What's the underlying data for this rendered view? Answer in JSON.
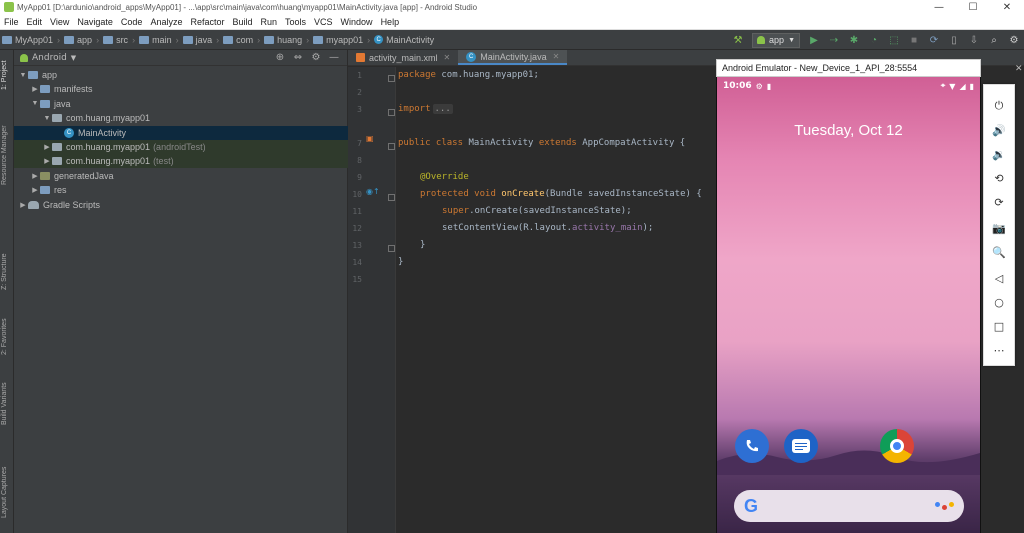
{
  "window": {
    "title": "MyApp01 [D:\\ardunio\\android_apps\\MyApp01] - ...\\app\\src\\main\\java\\com\\huang\\myapp01\\MainActivity.java [app] - Android Studio",
    "minimize": "—",
    "maximize": "☐",
    "close": "✕"
  },
  "menu": [
    "File",
    "Edit",
    "View",
    "Navigate",
    "Code",
    "Analyze",
    "Refactor",
    "Build",
    "Run",
    "Tools",
    "VCS",
    "Window",
    "Help"
  ],
  "breadcrumb": [
    "MyApp01",
    "app",
    "src",
    "main",
    "java",
    "com",
    "huang",
    "myapp01",
    "MainActivity"
  ],
  "toolbar": {
    "run_config": "app"
  },
  "left_stripe": [
    "1: Project",
    "Resource Manager",
    "Z: Structure",
    "2: Favorites",
    "Build Variants",
    "Layout Captures"
  ],
  "project": {
    "view_mode": "Android",
    "tree": [
      {
        "label": "app",
        "suffix": "",
        "indent": 0,
        "arrow": "▼",
        "icon": "folder"
      },
      {
        "label": "manifests",
        "suffix": "",
        "indent": 1,
        "arrow": "▶",
        "icon": "folder"
      },
      {
        "label": "java",
        "suffix": "",
        "indent": 1,
        "arrow": "▼",
        "icon": "folder"
      },
      {
        "label": "com.huang.myapp01",
        "suffix": "",
        "indent": 2,
        "arrow": "▼",
        "icon": "pkg"
      },
      {
        "label": "MainActivity",
        "suffix": "",
        "indent": 3,
        "arrow": "",
        "icon": "cls"
      },
      {
        "label": "com.huang.myapp01",
        "suffix": "(androidTest)",
        "indent": 2,
        "arrow": "▶",
        "icon": "pkg"
      },
      {
        "label": "com.huang.myapp01",
        "suffix": "(test)",
        "indent": 2,
        "arrow": "▶",
        "icon": "pkg"
      },
      {
        "label": "generatedJava",
        "suffix": "",
        "indent": 1,
        "arrow": "▶",
        "icon": "gen"
      },
      {
        "label": "res",
        "suffix": "",
        "indent": 1,
        "arrow": "▶",
        "icon": "folder"
      },
      {
        "label": "Gradle Scripts",
        "suffix": "",
        "indent": 0,
        "arrow": "▶",
        "icon": "gradle"
      }
    ]
  },
  "tabs": [
    {
      "label": "activity_main.xml",
      "active": false
    },
    {
      "label": "MainActivity.java",
      "active": true
    }
  ],
  "code": {
    "line_numbers": [
      "1",
      "2",
      "3",
      "",
      "7",
      "8",
      "9",
      "10",
      "11",
      "12",
      "13",
      "14",
      "15"
    ],
    "l1_kw": "package",
    "l1_rest": " com.huang.myapp01;",
    "l3_kw": "import",
    "l3_fold": "...",
    "l7_kw1": "public class",
    "l7_name": " MainActivity ",
    "l7_kw2": "extends",
    "l7_rest": " AppCompatActivity {",
    "l9_ann": "@Override",
    "l10_kw": "protected void",
    "l10_fn": "onCreate",
    "l10_rest": "(Bundle savedInstanceState) {",
    "l11_kw": "super",
    "l11_rest": ".onCreate(savedInstanceState);",
    "l12_pre": "setContentView(R.layout.",
    "l12_fld": "activity_main",
    "l12_post": ");",
    "l13": "}",
    "l14": "}"
  },
  "emulator": {
    "title": "Android Emulator - New_Device_1_API_28:5554",
    "time": "10:06",
    "date": "Tuesday, Oct 12",
    "google_letter": "G",
    "close_icon": "✕"
  },
  "emulator_controls": [
    "⏻",
    "🔊",
    "🔉",
    "⟲",
    "⟳",
    "📷",
    "🔍",
    "◁",
    "○",
    "□",
    "⋯"
  ],
  "colors": {
    "accent": "#4a88c7",
    "selection": "#0d293e",
    "keyword": "#cc7832",
    "annotation": "#bbb529",
    "function": "#ffc66d"
  }
}
